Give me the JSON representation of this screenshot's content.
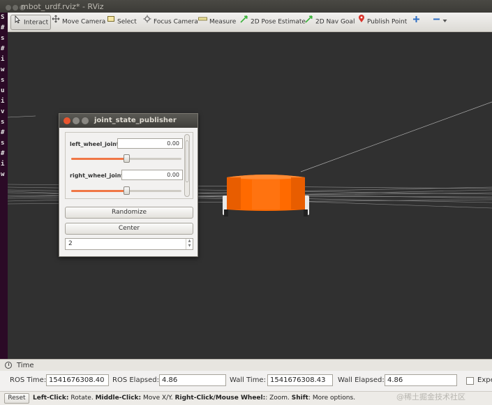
{
  "window": {
    "title": "mbot_urdf.rviz* - RViz"
  },
  "terminal_chars": [
    "S",
    "#",
    "s",
    "#",
    "i",
    "w",
    "s",
    "u",
    "i",
    "v",
    "s",
    "#",
    "s",
    "#",
    "i",
    "w"
  ],
  "toolbar": {
    "interact": "Interact",
    "move_camera": "Move Camera",
    "select": "Select",
    "focus_camera": "Focus Camera",
    "measure": "Measure",
    "pose_estimate": "2D Pose Estimate",
    "nav_goal": "2D Nav Goal",
    "publish_point": "Publish Point"
  },
  "joint_state_publisher": {
    "title": "joint_state_publisher",
    "joints": [
      {
        "label": "left_wheel_joint",
        "value": "0.00",
        "slider_fraction": 0.5
      },
      {
        "label": "right_wheel_joint",
        "value": "0.00",
        "slider_fraction": 0.5
      }
    ],
    "randomize": "Randomize",
    "center": "Center",
    "spin_value": "2"
  },
  "time_panel": {
    "title": "Time",
    "ros_time_label": "ROS Time:",
    "ros_time": "1541676308.40",
    "ros_elapsed_label": "ROS Elapsed:",
    "ros_elapsed": "4.86",
    "wall_time_label": "Wall Time:",
    "wall_time": "1541676308.43",
    "wall_elapsed_label": "Wall Elapsed:",
    "wall_elapsed": "4.86",
    "experimental_label": "Expe"
  },
  "status": {
    "reset": "Reset",
    "left_click": "Left-Click:",
    "left_action": " Rotate. ",
    "middle_click": "Middle-Click:",
    "middle_action": " Move X/Y. ",
    "right_click": "Right-Click/Mouse Wheel:",
    "right_action": ": Zoom. ",
    "shift": "Shift",
    "shift_action": ": More options."
  },
  "watermark": "@稀土掘金技术社区",
  "colors": {
    "robot_body": "#ff6a00",
    "accent": "#f07746",
    "viewport_bg": "#303030"
  }
}
